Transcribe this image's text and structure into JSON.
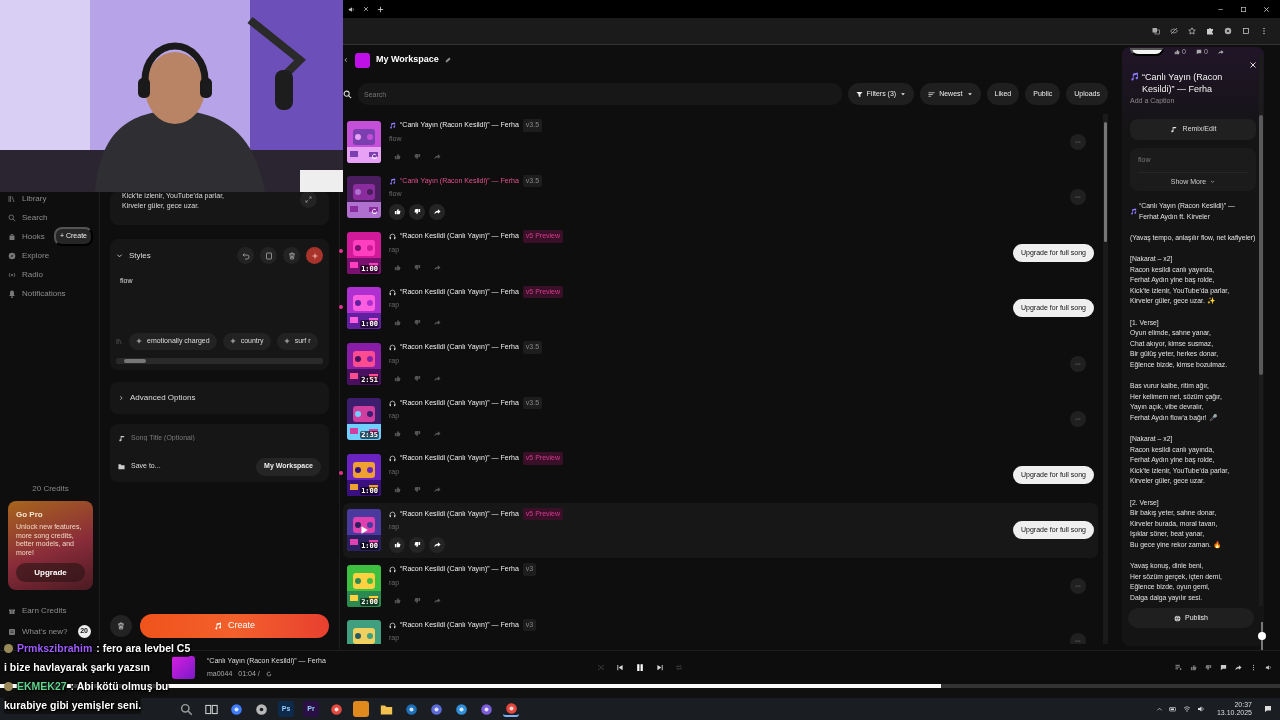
{
  "sidebar": {
    "items": [
      {
        "label": "Library"
      },
      {
        "label": "Search"
      },
      {
        "label": "Hooks",
        "badge": "+ Create"
      },
      {
        "label": "Explore"
      },
      {
        "label": "Radio"
      },
      {
        "label": "Notifications"
      }
    ],
    "credits": "20 Credits",
    "promo": {
      "title": "Go Pro",
      "text": "Unlock new features, more song credits, better models, and more!",
      "button": "Upgrade"
    },
    "footer": [
      {
        "label": "Earn Credits"
      },
      {
        "label": "What's new?",
        "count": "20"
      }
    ]
  },
  "create_panel": {
    "lyrics_lines": [
      "Kick'te izlenir, YouTube'da parlar,",
      "Kirveler güler, gece uzar."
    ],
    "styles": {
      "title": "Styles",
      "expanded": true,
      "value": "flow",
      "suggestions": [
        "emotionally charged",
        "country",
        "surf r"
      ]
    },
    "advanced": {
      "title": "Advanced Options",
      "expanded": false
    },
    "song_title": {
      "placeholder": "Song Title (Optional)"
    },
    "save_to": {
      "label": "Save to...",
      "value": "My Workspace"
    },
    "create_button": "Create"
  },
  "workspace": {
    "title": "My Workspace",
    "search": {
      "placeholder": "Search"
    },
    "filters": [
      {
        "label": "Filters (3)",
        "kind": "dropdown",
        "selected": false
      },
      {
        "label": "Newest",
        "kind": "dropdown",
        "selected": false
      },
      {
        "label": "Liked",
        "kind": "toggle",
        "selected": false
      },
      {
        "label": "Public",
        "kind": "toggle",
        "selected": false
      },
      {
        "label": "Uploads",
        "kind": "toggle",
        "selected": false
      }
    ]
  },
  "songs": [
    {
      "kind": "note",
      "title": "“Canlı Yayın (Racon Kesildi)” — Ferha",
      "version": "v3.5",
      "preview": false,
      "style": "flow",
      "loading": true,
      "playing": false,
      "hovered": false,
      "unplayed": false
    },
    {
      "kind": "note",
      "title": "“Canlı Yayın (Racon Kesildi)” — Ferha",
      "version": "v3.5",
      "preview": false,
      "style": "flow",
      "loading": true,
      "playing": true,
      "hovered": false,
      "unplayed": false
    },
    {
      "kind": "listen",
      "title": "“Racon Kesildi (Canlı Yayın)” — Ferha",
      "version": "v5 Preview",
      "preview": true,
      "style": "rap",
      "duration": "1:00",
      "loading": false,
      "playing": false,
      "hovered": false,
      "unplayed": true,
      "upgrade": "Upgrade for full song"
    },
    {
      "kind": "listen",
      "title": "“Racon Kesildi (Canlı Yayın)” — Ferha",
      "version": "v5 Preview",
      "preview": true,
      "style": "rap",
      "duration": "1:00",
      "loading": false,
      "playing": false,
      "hovered": false,
      "unplayed": true,
      "upgrade": "Upgrade for full song"
    },
    {
      "kind": "listen",
      "title": "“Racon Kesildi (Canlı Yayın)” — Ferha",
      "version": "v3.5",
      "preview": false,
      "style": "rap",
      "duration": "2:51",
      "loading": false,
      "playing": false,
      "hovered": false,
      "unplayed": false
    },
    {
      "kind": "listen",
      "title": "“Racon Kesildi (Canlı Yayın)” — Ferha",
      "version": "v3.5",
      "preview": false,
      "style": "rap",
      "duration": "2:35",
      "loading": false,
      "playing": false,
      "hovered": false,
      "unplayed": false
    },
    {
      "kind": "listen",
      "title": "“Racon Kesildi (Canlı Yayın)” — Ferha",
      "version": "v5 Preview",
      "preview": true,
      "style": "rap",
      "duration": "1:00",
      "loading": false,
      "playing": false,
      "hovered": false,
      "unplayed": true,
      "upgrade": "Upgrade for full song"
    },
    {
      "kind": "listen",
      "title": "“Racon Kesildi (Canlı Yayın)” — Ferha",
      "version": "v5 Preview",
      "preview": true,
      "style": "rap",
      "duration": "1:00",
      "loading": false,
      "playing": false,
      "hovered": true,
      "unplayed": false,
      "upgrade": "Upgrade for full song"
    },
    {
      "kind": "listen",
      "title": "“Racon Kesildi (Canlı Yayın)” — Ferha",
      "version": "v3",
      "preview": false,
      "style": "rap",
      "duration": "2:00",
      "loading": false,
      "playing": false,
      "hovered": false,
      "unplayed": false
    },
    {
      "kind": "listen",
      "title": "“Racon Kesildi (Canlı Yayın)” — Ferha",
      "version": "v3",
      "preview": false,
      "style": "rap",
      "actions_hidden": true,
      "loading": false,
      "playing": false,
      "hovered": false,
      "unplayed": false
    }
  ],
  "details": {
    "like_count": "0",
    "comment_count": "0",
    "title": "“Canlı Yayın (Racon Kesildi)” — Ferha",
    "caption_placeholder": "Add a Caption",
    "remix_button": "Remix/Edit",
    "style": "flow",
    "show_more": "Show More",
    "lyrics_heading": "“Canlı Yayın (Racon Kesildi)” — Ferhat Aydın ft. Kirveler",
    "lyrics": [
      [
        "(Yavaş tempo, anlaşılır flow, net kafiyeler)"
      ],
      [
        "[Nakarat – x2]",
        "Racon kesildi canlı yayında,",
        "Ferhat Aydın yine baş rolde,",
        "Kick'te izlenir, YouTube'da parlar,",
        "Kirveler güler, gece uzar. ✨"
      ],
      [
        "[1. Verse]",
        "Oyun elimde, sahne yanar,",
        "Chat akıyor, kimse susmaz,",
        "Bir gülüş yeter, herkes donar,",
        "Eğlence bizde, kimse bozulmaz."
      ],
      [
        "Bas vurur kalbe, ritim ağır,",
        "Her kelimem net, sözüm çağır,",
        "Yayın açık, vibe devralır,",
        "Ferhat Aydın flow'a bağır! 🎤"
      ],
      [
        "[Nakarat – x2]",
        "Racon kesildi canlı yayında,",
        "Ferhat Aydın yine baş rolde,",
        "Kick'te izlenir, YouTube'da parlar,",
        "Kirveler güler, gece uzar."
      ],
      [
        "[2. Verse]",
        "Bir bakış yeter, sahne donar,",
        "Kirveler burada, moral tavan,",
        "Işıklar söner, beat yanar,",
        "Bu gece yine rekor zaman. 🔥"
      ],
      [
        "Yavaş konuş, dinle beni,",
        "Her sözüm gerçek, içten demi,",
        "Eğlence bizde, oyun gemi,",
        "Dalga dalga yayılır sesi."
      ]
    ],
    "publish": "Publish"
  },
  "player": {
    "title": "“Canlı Yayın (Racon Kesildi)” — Ferha",
    "artist": "ma0044",
    "time": "01:04 /",
    "playing": true,
    "progress": {
      "level": 0.735
    },
    "volume": {
      "level": 0.6
    }
  },
  "chat": [
    {
      "user": "Prmkszibrahim",
      "color": "#a05cff",
      "lines": [
        ": fero ara levbel C5",
        "i bize havlayarak şarkı yazsın"
      ]
    },
    {
      "user": "EKMEK27",
      "color": "#5fd38a",
      "lines": [
        ": Abi kötü olmuş bu",
        "kurabiye gibi yemişler seni."
      ]
    }
  ],
  "taskbar": {
    "apps": [
      {
        "kind": "search",
        "color": "#9a9a9a"
      },
      {
        "kind": "taskview",
        "color": "#cfcfcf"
      },
      {
        "kind": "orb",
        "color": "#3d7bff"
      },
      {
        "kind": "gear",
        "color": "#b8b8b8"
      },
      {
        "kind": "tile",
        "color": "#0d2a4a",
        "label": "Ps"
      },
      {
        "kind": "tile",
        "color": "#2a0f45",
        "label": "Pr"
      },
      {
        "kind": "orb",
        "color": "#e2483d"
      },
      {
        "kind": "tile",
        "color": "#e08a1e"
      },
      {
        "kind": "folder",
        "color": "#f2c14e"
      },
      {
        "kind": "orb",
        "color": "#1d6fb8"
      },
      {
        "kind": "orb",
        "color": "#5a6bd8"
      },
      {
        "kind": "orb",
        "color": "#2f8fd8"
      },
      {
        "kind": "orb",
        "color": "#7a5cd8"
      },
      {
        "kind": "orb",
        "color": "#e2483d"
      }
    ],
    "time": "20:37",
    "date": "13.10.2025"
  }
}
